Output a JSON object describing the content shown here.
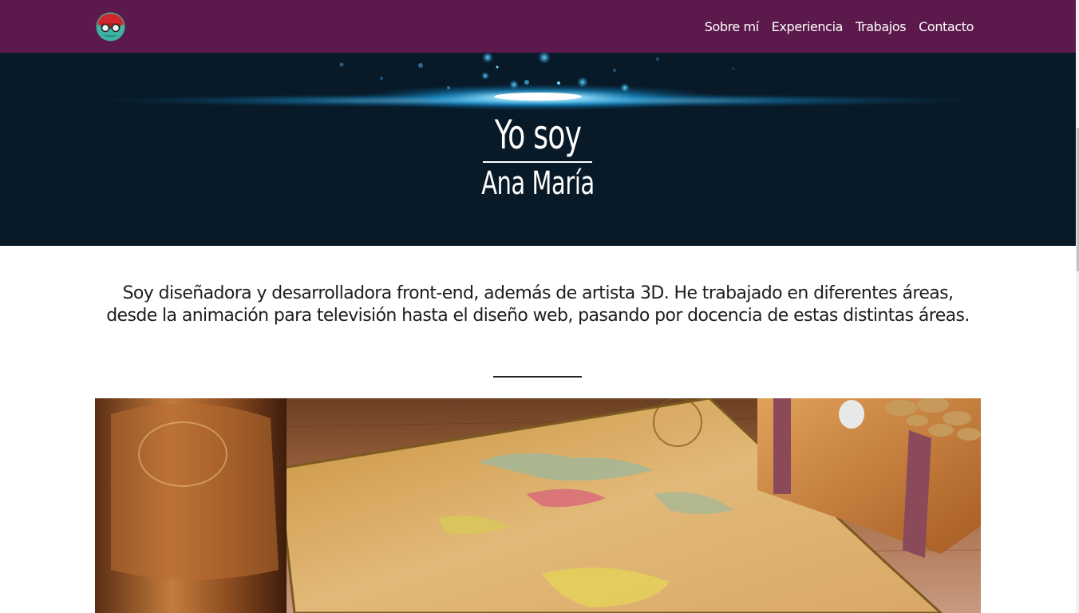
{
  "nav": {
    "logo_icon": "avatar-logo-icon",
    "links": [
      "Sobre mí",
      "Experiencia",
      "Trabajos",
      "Contacto"
    ]
  },
  "hero": {
    "greeting": "Yo soy",
    "name": "Ana María"
  },
  "intro": {
    "text": "Soy diseñadora y desarrolladora front-end, además de artista 3D. He trabajado en diferentes áreas, desde la animación para televisión hasta el diseño web, pasando por docencia de estas distintas áreas."
  },
  "colors": {
    "navbar": "#5c1a4c",
    "hero_bg": "#081a28",
    "text": "#1e1e1e"
  }
}
